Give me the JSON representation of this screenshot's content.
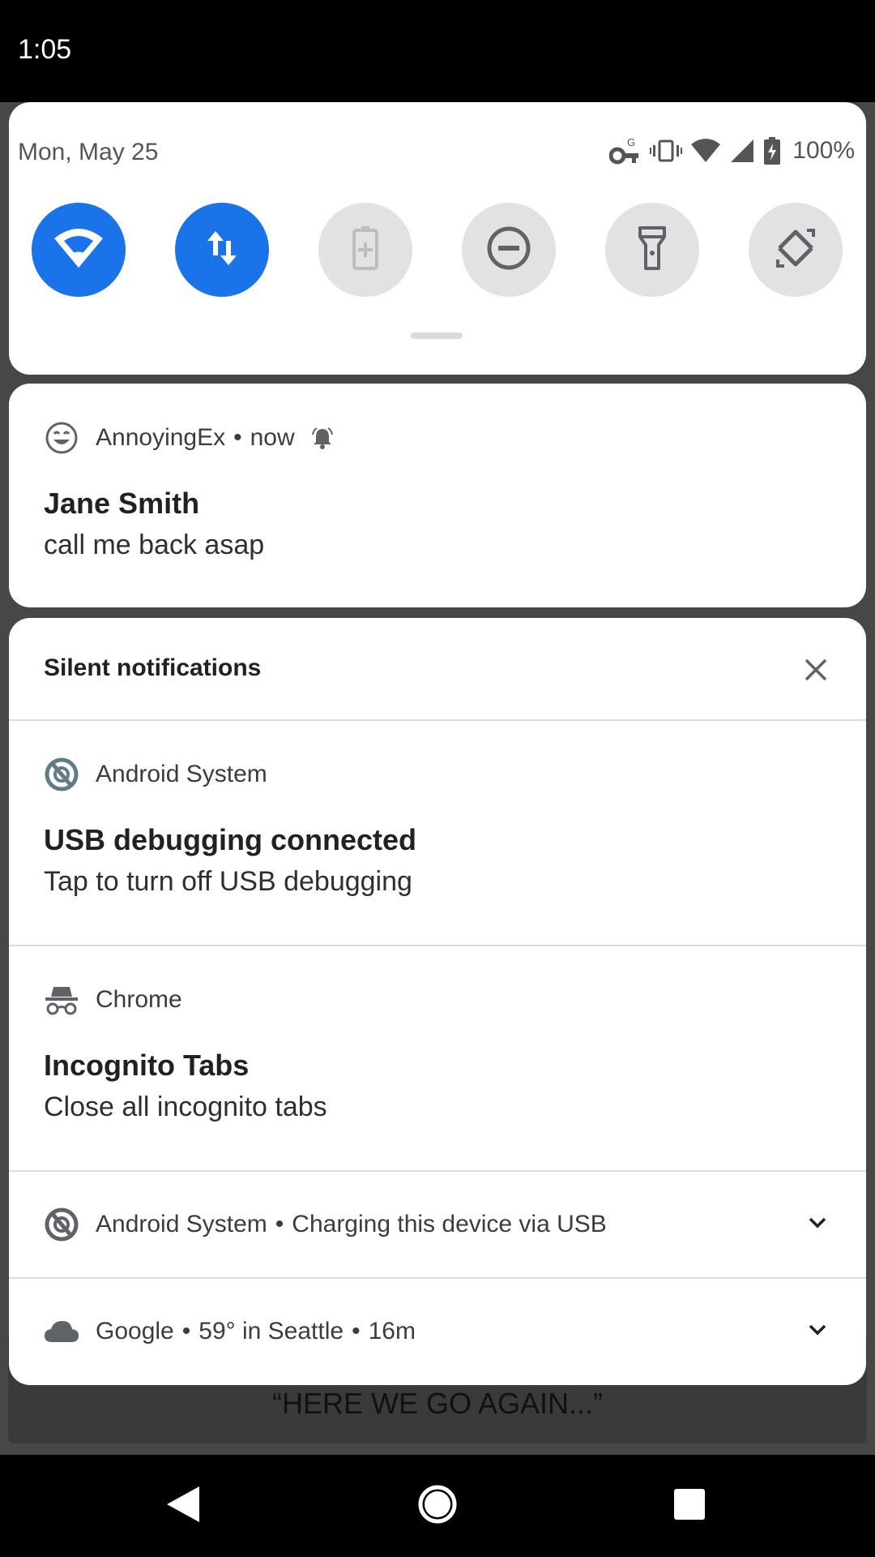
{
  "status_bar": {
    "time": "1:05"
  },
  "background": {
    "banner_text": "“HERE WE GO AGAIN...”"
  },
  "quick_settings": {
    "date": "Mon, May 25",
    "battery_percent": "100%",
    "tiles": [
      {
        "icon": "wifi-icon",
        "state": "on"
      },
      {
        "icon": "mobile-data-icon",
        "state": "on"
      },
      {
        "icon": "battery-saver-icon",
        "state": "off"
      },
      {
        "icon": "do-not-disturb-icon",
        "state": "off"
      },
      {
        "icon": "flashlight-icon",
        "state": "off"
      },
      {
        "icon": "auto-rotate-icon",
        "state": "off"
      }
    ],
    "accent_color": "#1a73e8"
  },
  "alerting_notification": {
    "app_name": "AnnoyingEx",
    "time": "now",
    "title": "Jane Smith",
    "body": "call me back asap"
  },
  "silent_section": {
    "title": "Silent notifications",
    "notifications": [
      {
        "app_name": "Android System",
        "title": "USB debugging connected",
        "body": "Tap to turn off USB debugging"
      },
      {
        "app_name": "Chrome",
        "title": "Incognito Tabs",
        "body": "Close all incognito tabs"
      }
    ],
    "collapsed": [
      {
        "app_name": "Android System",
        "summary": "Charging this device via USB"
      },
      {
        "app_name": "Google",
        "summary": "59° in Seattle",
        "time": "16m"
      }
    ]
  }
}
